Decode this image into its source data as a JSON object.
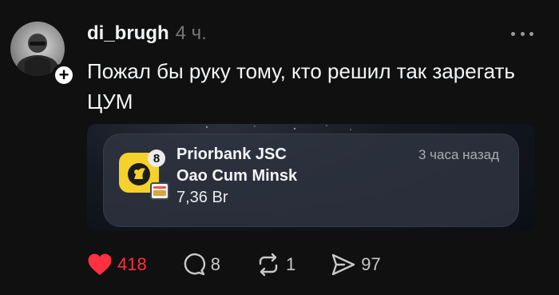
{
  "post": {
    "username": "di_brugh",
    "timestamp": "4 ч.",
    "text": "Пожал бы руку тому, кто решил так зарегать ЦУМ"
  },
  "attachment": {
    "notification": {
      "app_badge": "8",
      "title": "Priorbank JSC",
      "time": "3 часа назад",
      "merchant": "Oao Cum Minsk",
      "amount": "7,36 Br"
    }
  },
  "actions": {
    "likes": "418",
    "replies": "8",
    "reposts": "1",
    "shares": "97"
  },
  "icons": {
    "avatar": "avatar",
    "follow": "plus-icon",
    "more": "more-icon",
    "like": "heart-icon",
    "reply": "comment-icon",
    "repost": "repost-icon",
    "share": "send-icon"
  },
  "colors": {
    "background": "#101010",
    "like_active": "#ff3040",
    "app_icon": "#f4d12b"
  }
}
